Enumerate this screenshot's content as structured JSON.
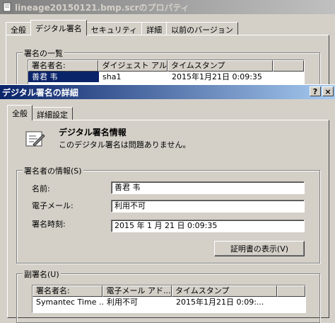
{
  "back_window": {
    "title": "lineage20150121.bmp.scrのプロパティ",
    "tabs": [
      "全般",
      "デジタル署名",
      "セキュリティ",
      "詳細",
      "以前のバージョン"
    ],
    "active_tab": 1,
    "signature_list": {
      "legend": "署名の一覧",
      "columns": [
        "署名者名:",
        "ダイジェスト アル...",
        "タイムスタンプ"
      ],
      "rows": [
        [
          "善君 韦",
          "sha1",
          "2015年1月21日 0:09:35"
        ]
      ]
    }
  },
  "dialog": {
    "title": "デジタル署名の詳細",
    "help_btn": "?",
    "close_btn": "×",
    "tabs": [
      "全般",
      "詳細設定"
    ],
    "info": {
      "heading": "デジタル署名情報",
      "status": "このデジタル署名は問題ありません。"
    },
    "signer": {
      "legend": "署名者の情報(S)",
      "name_label": "名前:",
      "name_value": "善君 韦",
      "email_label": "電子メール:",
      "email_value": "利用不可",
      "time_label": "署名時刻:",
      "time_value": "2015 年 1 月 21 日 0:09:35",
      "view_cert_btn": "証明書の表示(V)"
    },
    "countersign": {
      "legend": "副署名(U)",
      "columns": [
        "署名者名:",
        "電子メール アド...",
        "タイムスタンプ"
      ],
      "rows": [
        [
          "Symantec Time ...",
          "利用不可",
          "2015年1月21日 0:09:..."
        ]
      ]
    }
  }
}
